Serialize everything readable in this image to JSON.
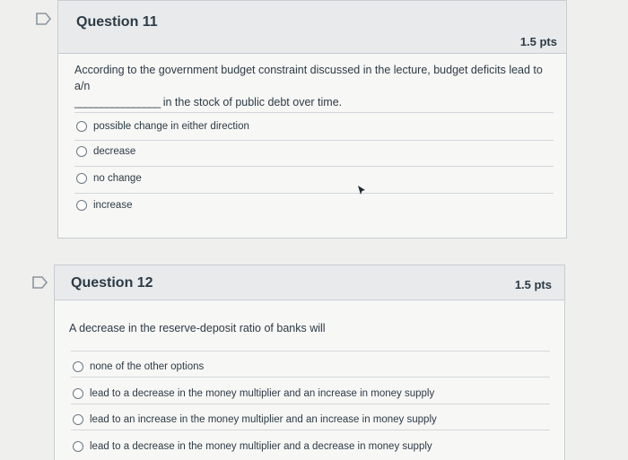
{
  "question11": {
    "title": "Question 11",
    "points": "1.5 pts",
    "text_line1": "According to the government budget constraint discussed in the lecture, budget deficits lead to a/n",
    "blank": "________________",
    "text_line2": "in the stock of public debt over time.",
    "answers": [
      "possible change in either direction",
      "decrease",
      "no change",
      "increase"
    ]
  },
  "question12": {
    "title": "Question 12",
    "points": "1.5 pts",
    "text": "A decrease in the reserve-deposit ratio of banks will",
    "answers": [
      "none of the other options",
      "lead to a decrease in the money multiplier and an increase in money supply",
      "lead to an increase in the money multiplier and an increase in money supply",
      "lead to a decrease in the money multiplier and a decrease in money supply"
    ]
  },
  "icons": {
    "flag": "flag-icon",
    "cursor": "mouse-pointer-icon"
  }
}
